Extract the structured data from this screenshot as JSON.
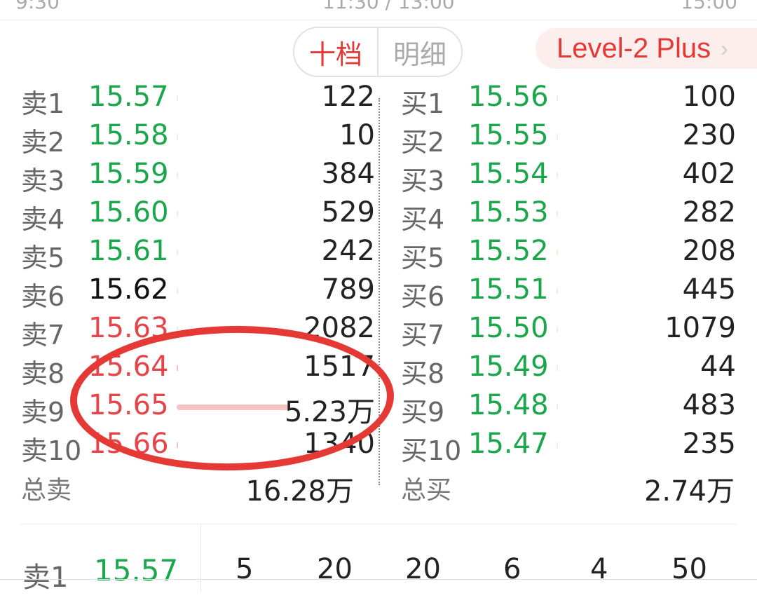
{
  "time_axis": {
    "start": "9:30",
    "mid": "11:30 / 13:00",
    "end": "15:00"
  },
  "tabs": [
    {
      "label": "十档",
      "active": true
    },
    {
      "label": "明细",
      "active": false
    }
  ],
  "level2": {
    "label": "Level-2 Plus"
  },
  "sell_orders": [
    {
      "label": "卖1",
      "price": "15.57",
      "volume": "122",
      "color": "#1aa64a"
    },
    {
      "label": "卖2",
      "price": "15.58",
      "volume": "10",
      "color": "#1aa64a"
    },
    {
      "label": "卖3",
      "price": "15.59",
      "volume": "384",
      "color": "#1aa64a"
    },
    {
      "label": "卖4",
      "price": "15.60",
      "volume": "529",
      "color": "#1aa64a"
    },
    {
      "label": "卖5",
      "price": "15.61",
      "volume": "242",
      "color": "#1aa64a"
    },
    {
      "label": "卖6",
      "price": "15.62",
      "volume": "789",
      "color": "#111111"
    },
    {
      "label": "卖7",
      "price": "15.63",
      "volume": "2082",
      "color": "#e5454a"
    },
    {
      "label": "卖8",
      "price": "15.64",
      "volume": "1517",
      "color": "#e5454a"
    },
    {
      "label": "卖9",
      "price": "15.65",
      "volume": "5.23万",
      "color": "#e5454a"
    },
    {
      "label": "卖10",
      "price": "15.66",
      "volume": "1340",
      "color": "#e5454a"
    }
  ],
  "buy_orders": [
    {
      "label": "买1",
      "price": "15.56",
      "volume": "100",
      "color": "#1aa64a"
    },
    {
      "label": "买2",
      "price": "15.55",
      "volume": "230",
      "color": "#1aa64a"
    },
    {
      "label": "买3",
      "price": "15.54",
      "volume": "402",
      "color": "#1aa64a"
    },
    {
      "label": "买4",
      "price": "15.53",
      "volume": "282",
      "color": "#1aa64a"
    },
    {
      "label": "买5",
      "price": "15.52",
      "volume": "208",
      "color": "#1aa64a"
    },
    {
      "label": "买6",
      "price": "15.51",
      "volume": "445",
      "color": "#1aa64a"
    },
    {
      "label": "买7",
      "price": "15.50",
      "volume": "1079",
      "color": "#1aa64a"
    },
    {
      "label": "买8",
      "price": "15.49",
      "volume": "44",
      "color": "#1aa64a"
    },
    {
      "label": "买9",
      "price": "15.48",
      "volume": "483",
      "color": "#1aa64a"
    },
    {
      "label": "买10",
      "price": "15.47",
      "volume": "235",
      "color": "#1aa64a"
    }
  ],
  "totals": {
    "sell_label": "总卖",
    "sell_value": "16.28万",
    "buy_label": "总买",
    "buy_value": "2.74万"
  },
  "queue": {
    "label": "卖1",
    "price": "15.57",
    "quantities": [
      "5",
      "20",
      "20",
      "6",
      "4",
      "50"
    ]
  },
  "colors": {
    "accent": "#e53935",
    "up": "#e5454a",
    "down": "#1aa64a"
  }
}
